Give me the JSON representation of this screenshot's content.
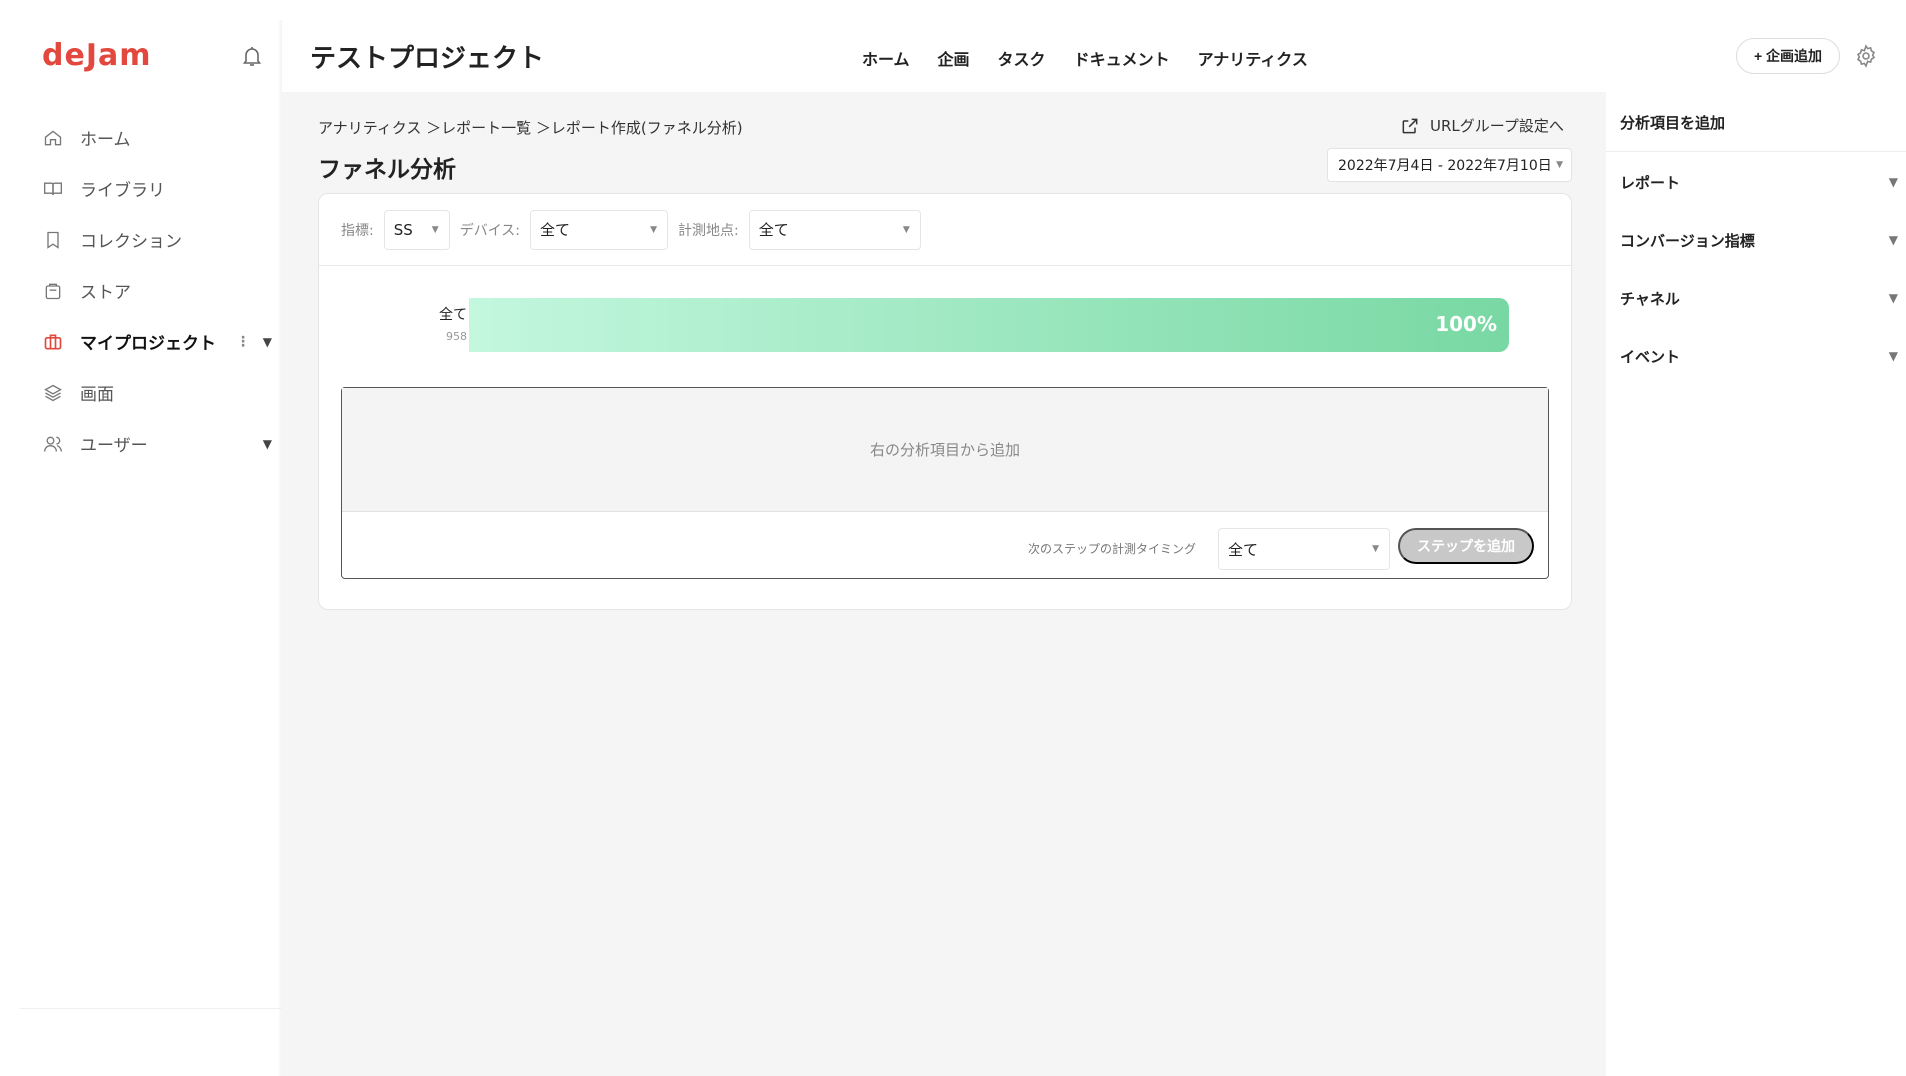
{
  "app": {
    "logo": "deJam"
  },
  "sidebar": {
    "items": [
      {
        "label": "ホーム",
        "icon": "home-icon"
      },
      {
        "label": "ライブラリ",
        "icon": "book-icon"
      },
      {
        "label": "コレクション",
        "icon": "bookmark-icon"
      },
      {
        "label": "ストア",
        "icon": "store-icon"
      },
      {
        "label": "マイプロジェクト",
        "icon": "briefcase-icon",
        "more": "⋮",
        "caret": "▼"
      },
      {
        "label": "画面",
        "icon": "layers-icon"
      },
      {
        "label": "ユーザー",
        "icon": "users-icon",
        "caret": "▼"
      }
    ]
  },
  "header": {
    "project_title": "テストプロジェクト",
    "nav": [
      "ホーム",
      "企画",
      "タスク",
      "ドキュメント",
      "アナリティクス"
    ],
    "add_plan_label": "+ 企画追加"
  },
  "main": {
    "breadcrumb": "アナリティクス ＞レポート一覧 ＞レポート作成(ファネル分析)",
    "url_link": "URLグループ設定へ",
    "page_title": "ファネル分析",
    "date_range": "2022年7月4日 - 2022年7月10日",
    "filters": {
      "metric_label": "指標:",
      "metric_value": "SS",
      "device_label": "デバイス:",
      "device_value": "全て",
      "point_label": "計測地点:",
      "point_value": "全て"
    },
    "funnel": {
      "name": "全て",
      "count": "958",
      "percent_text": "100%",
      "percent": 100
    },
    "add_placeholder": "右の分析項目から追加",
    "timing_label": "次のステップの計測タイミング",
    "timing_value": "全て",
    "add_step_label": "ステップを追加"
  },
  "right_panel": {
    "title": "分析項目を追加",
    "sections": [
      "レポート",
      "コンバージョン指標",
      "チャネル",
      "イベント"
    ]
  },
  "colors": {
    "brand": "#e2483d",
    "funnel_start": "#c3f7de",
    "funnel_end": "#78d8a3"
  }
}
